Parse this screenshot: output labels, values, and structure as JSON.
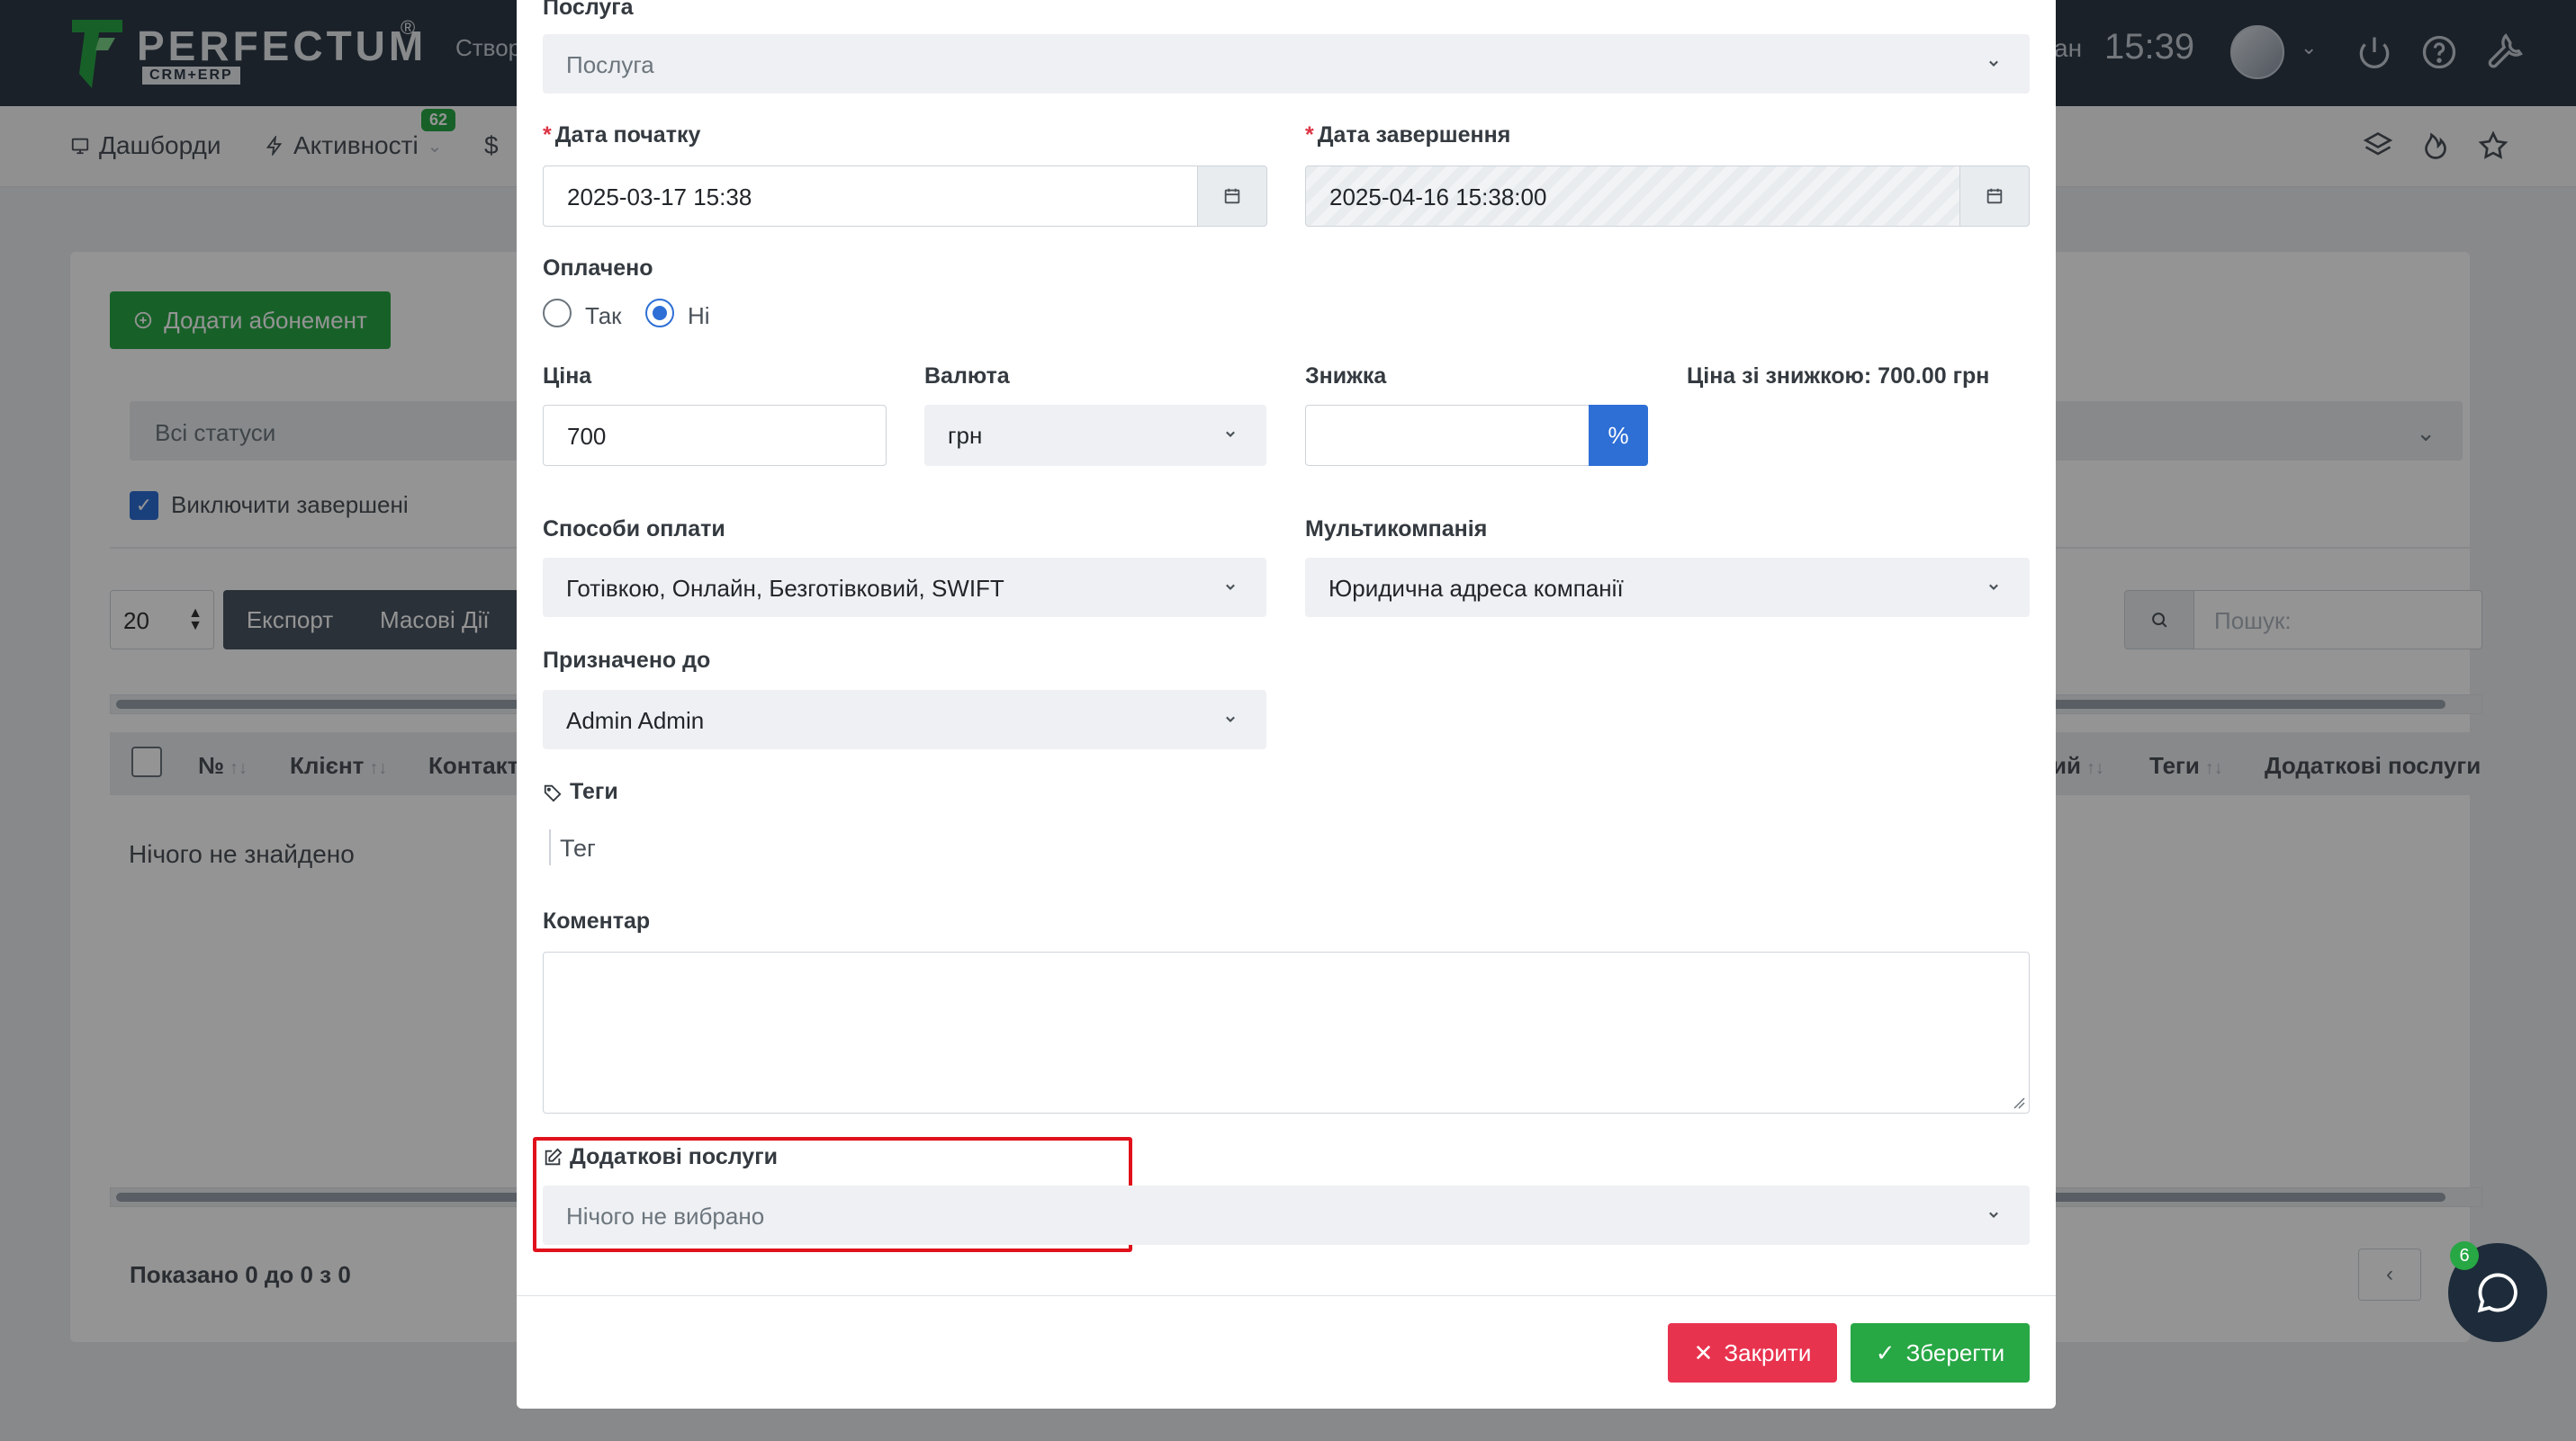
{
  "topbar": {
    "brand": "PERFECTUM",
    "brand_reg": "®",
    "brand_sub": "CRM+ERP",
    "create_fragment": "Створ",
    "right_fragment": "ан",
    "time": "15:39"
  },
  "navbar": {
    "dashboards": "Дашборди",
    "activities": "Активності",
    "activities_badge": "62",
    "currency_symbol": "$"
  },
  "background": {
    "add_button": "Додати абонемент",
    "status_filter": "Всі статуси",
    "exclude_completed": "Виключити завершені",
    "per_page": "20",
    "export": "Експорт",
    "mass_actions": "Масові Дії",
    "search_placeholder": "Пошук:",
    "table_headers": {
      "number": "№",
      "client": "Клієнт",
      "contact": "Контакт",
      "right_fragment": "ий",
      "tags": "Теги",
      "extra_services": "Додаткові послуги"
    },
    "empty": "Нічого не знайдено",
    "showing": "Показано 0 до 0 з 0",
    "chat_badge": "6"
  },
  "modal": {
    "service_label": "Послуга",
    "service_value": "Послуга",
    "start_label": "Дата початку",
    "start_value": "2025-03-17 15:38",
    "end_label": "Дата завершення",
    "end_value": "2025-04-16 15:38:00",
    "paid_label": "Оплачено",
    "paid_yes": "Так",
    "paid_no": "Ні",
    "price_label": "Ціна",
    "price_value": "700",
    "currency_label": "Валюта",
    "currency_value": "грн",
    "discount_label": "Знижка",
    "discount_value": "",
    "discount_unit": "%",
    "discounted_price": "Ціна зі знижкою: 700.00 грн",
    "payment_methods_label": "Способи оплати",
    "payment_methods_value": "Готівкою, Онлайн, Безготівковий, SWIFT",
    "multicompany_label": "Мультикомпанія",
    "multicompany_value": "Юридична адреса компанії",
    "assigned_label": "Призначено до",
    "assigned_value": "Admin Admin",
    "tags_label": "Теги",
    "tags_placeholder": "Тег",
    "comment_label": "Коментар",
    "comment_value": "",
    "extra_services_label": "Додаткові послуги",
    "extra_services_value": "Нічого не вибрано",
    "close_button": "Закрити",
    "save_button": "Зберегти"
  },
  "colors": {
    "accent_blue": "#2e6fd6",
    "success_green": "#28a745",
    "danger_red": "#e8334f",
    "highlight_red": "#e0111b",
    "topbar_bg": "#2e3a47"
  }
}
